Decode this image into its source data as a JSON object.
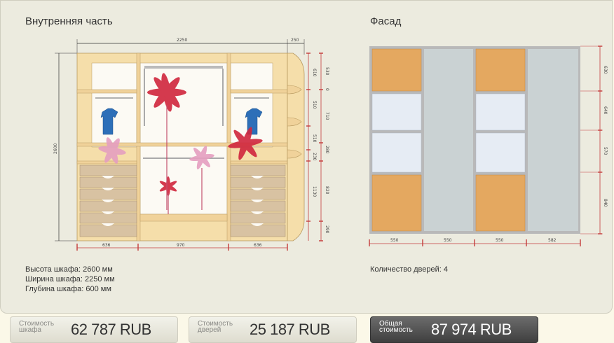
{
  "interior": {
    "title": "Внутренняя часть",
    "dims": {
      "total_width": "2250",
      "side_width": "250",
      "height": "2600",
      "bottom": [
        "636",
        "970",
        "636"
      ],
      "right": [
        "530",
        "610",
        "0",
        "510",
        "710",
        "510",
        "280",
        "230",
        "820",
        "1130",
        "290"
      ]
    }
  },
  "facade": {
    "title": "Фасад",
    "dims": {
      "bottom": [
        "550",
        "550",
        "550",
        "582"
      ],
      "right": [
        "630",
        "640",
        "570",
        "840"
      ]
    }
  },
  "specs": {
    "height": "Высота шкафа: 2600 мм",
    "width": "Ширина шкафа: 2250 мм",
    "depth": "Глубина шкафа: 600 мм",
    "doors": "Количество дверей: 4"
  },
  "costs": {
    "wardrobe_label_1": "Стоимость",
    "wardrobe_label_2": "шкафа",
    "wardrobe_value": "62 787  RUB",
    "doors_label_1": "Стоимость",
    "doors_label_2": "дверей",
    "doors_value": "25 187  RUB",
    "total_label_1": "Общая",
    "total_label_2": "стоимость",
    "total_value": "87 974  RUB"
  },
  "colors": {
    "wood": "#f5deaa",
    "oak": "#e4a860",
    "mirror": "#c8cfd0",
    "dimension": "#c43b3b"
  }
}
